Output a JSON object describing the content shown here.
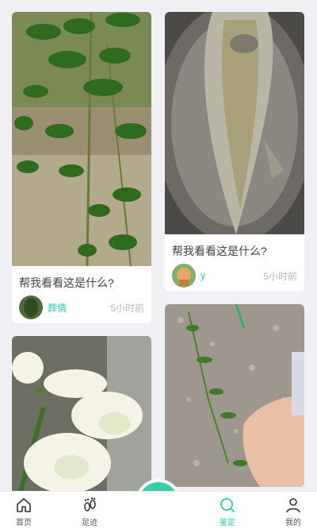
{
  "feed": {
    "cards": [
      {
        "question": "帮我看看这是什么?",
        "user": "葬情",
        "time": "5小时前"
      },
      {
        "question": "帮我看看这是什么?",
        "user": "y",
        "time": "5小时前"
      }
    ]
  },
  "tabbar": {
    "home": "首页",
    "footprints": "足迹",
    "identify": "鉴定",
    "mine": "我的"
  },
  "colors": {
    "accent": "#2fc9a4",
    "camera": "#33d1a8"
  },
  "icons": [
    "home-icon",
    "footprint-icon",
    "camera-icon",
    "identify-icon",
    "profile-icon"
  ]
}
